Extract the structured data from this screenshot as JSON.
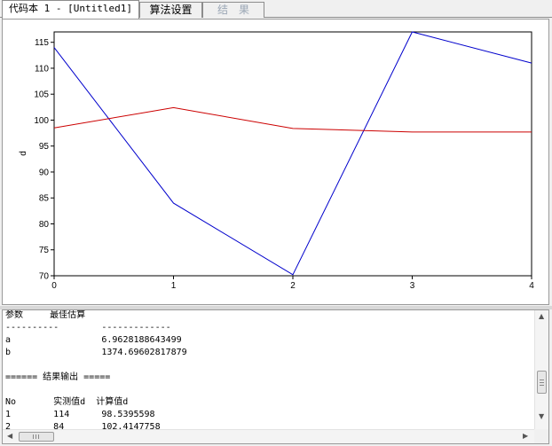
{
  "tabs": [
    {
      "label": "代码本 1 - [Untitled1]",
      "state": "active"
    },
    {
      "label": "算法设置",
      "state": "normal"
    },
    {
      "label": "结　果",
      "state": "disabled"
    }
  ],
  "chart_data": {
    "type": "line",
    "title": "",
    "xlabel": "",
    "ylabel": "d",
    "x": [
      0,
      1,
      2,
      3,
      4
    ],
    "xticks": [
      "0",
      "1",
      "2",
      "3",
      "4"
    ],
    "yticks": [
      "70",
      "75",
      "80",
      "85",
      "90",
      "95",
      "100",
      "105",
      "110",
      "115"
    ],
    "xlim": [
      0,
      4
    ],
    "ylim": [
      70,
      117
    ],
    "grid": false,
    "series": [
      {
        "color": "#0000cc",
        "values": [
          114,
          84,
          70.2,
          117,
          111
        ]
      },
      {
        "color": "#cc0000",
        "values": [
          98.5,
          102.4,
          98.4,
          97.7,
          97.7
        ]
      }
    ]
  },
  "output": {
    "lines": [
      "参数     最佳估算",
      "----------        -------------",
      "a                 6.9628188643499",
      "b                 1374.69602817879",
      "",
      "====== 结果输出 =====",
      "",
      "No       实测值d  计算值d",
      "1        114      98.5395598",
      "2        84       102.4147758"
    ]
  },
  "icons": {
    "scroll_up": "scroll-up-arrow-icon",
    "scroll_down": "scroll-down-arrow-icon",
    "scroll_left": "scroll-left-arrow-icon",
    "scroll_right": "scroll-right-arrow-icon"
  }
}
